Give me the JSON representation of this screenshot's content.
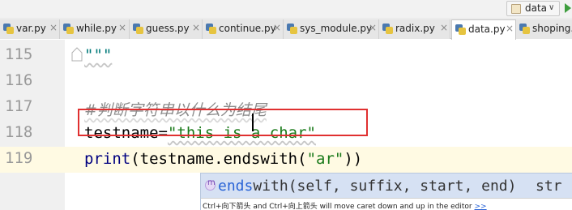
{
  "toolbar": {
    "run_config_label": "data",
    "run_config_arrow": "∨",
    "run_icon": "run-icon"
  },
  "tabs": [
    {
      "label": "var.py",
      "close": "×",
      "active": false
    },
    {
      "label": "while.py",
      "close": "×",
      "active": false
    },
    {
      "label": "guess.py",
      "close": "×",
      "active": false
    },
    {
      "label": "continue.py",
      "close": "×",
      "active": false
    },
    {
      "label": "sys_module.py",
      "close": "×",
      "active": false
    },
    {
      "label": "radix.py",
      "close": "×",
      "active": false
    },
    {
      "label": "data.py",
      "close": "×",
      "active": true
    },
    {
      "label": "shoping.",
      "close": "",
      "active": false
    }
  ],
  "editor": {
    "lines": [
      {
        "number": "115",
        "parts": {
          "doc": "\"\"\""
        }
      },
      {
        "number": "116"
      },
      {
        "number": "117",
        "parts": {
          "comment": "#判断字符串以什么为结尾"
        }
      },
      {
        "number": "118",
        "parts": {
          "ident": "testname=",
          "str": "\"this is a char\""
        }
      },
      {
        "number": "119",
        "current": true,
        "parts": {
          "builtin": "print",
          "open": "(",
          "ident": "testname.endswith",
          "open2": "(",
          "str": "\"ar\"",
          "close": "))"
        }
      }
    ]
  },
  "completion": {
    "match": "ends",
    "rest": "with(self, suffix, start, end)",
    "type": "str",
    "hint": "Ctrl+向下箭头 and Ctrl+向上箭头 will move caret down and up in the editor",
    "hint_link": ">>"
  },
  "colors": {
    "current_line": "#fffae3",
    "highlight_box": "#e03030",
    "string": "#1a7a1a",
    "builtin": "#000080",
    "popup_selected": "#d6e1f3"
  }
}
